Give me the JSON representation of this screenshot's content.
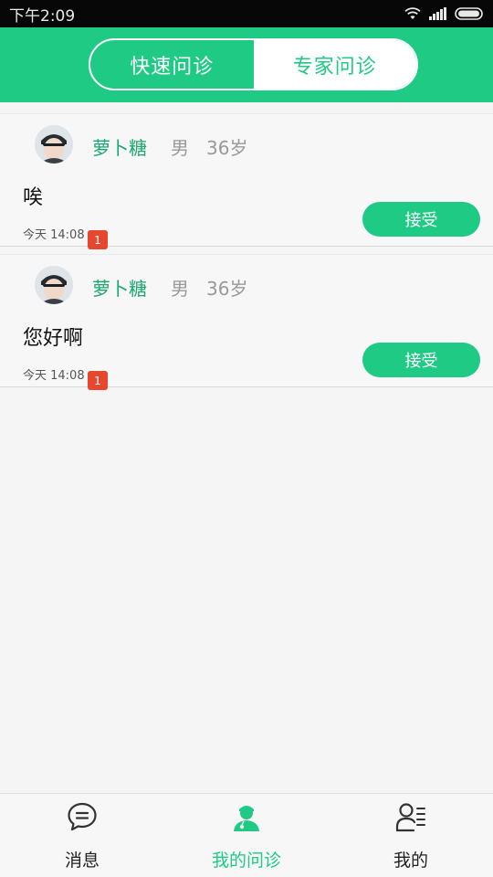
{
  "status_bar": {
    "time": "下午2:09"
  },
  "header": {
    "tabs": [
      {
        "label": "快速问诊",
        "active": false
      },
      {
        "label": "专家问诊",
        "active": true
      }
    ]
  },
  "consultations": [
    {
      "name": "萝卜糖",
      "gender": "男",
      "age": "36岁",
      "message": "唉",
      "time": "今天 14:08",
      "badge": "1",
      "accept_label": "接受"
    },
    {
      "name": "萝卜糖",
      "gender": "男",
      "age": "36岁",
      "message": "您好啊",
      "time": "今天 14:08",
      "badge": "1",
      "accept_label": "接受"
    }
  ],
  "tabbar": {
    "items": [
      {
        "label": "消息",
        "icon": "chat-bubble-icon",
        "active": false
      },
      {
        "label": "我的问诊",
        "icon": "doctor-icon",
        "active": true
      },
      {
        "label": "我的",
        "icon": "profile-list-icon",
        "active": false
      }
    ]
  },
  "colors": {
    "brand": "#1fca85",
    "badge": "#e5482e",
    "name": "#1aa86f"
  }
}
